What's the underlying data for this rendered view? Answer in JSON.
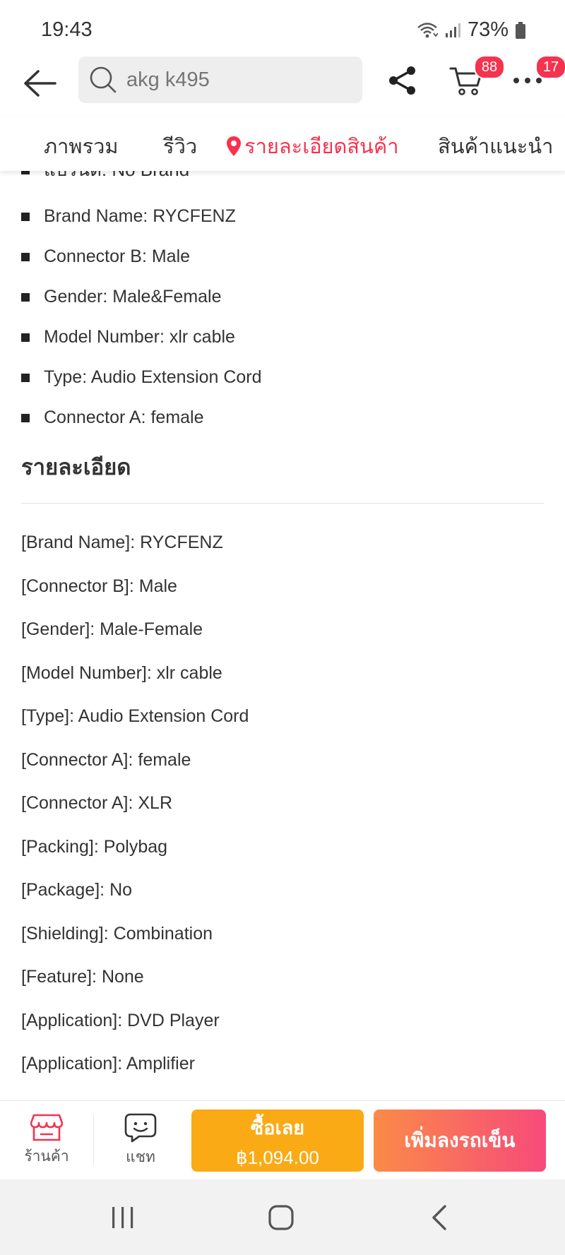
{
  "status_bar": {
    "time": "19:43",
    "battery": "73%",
    "icons": [
      "wifi-icon",
      "signal-icon",
      "battery-icon"
    ]
  },
  "header": {
    "search": {
      "value": "",
      "placeholder": "akg k495"
    },
    "cart_badge": "88",
    "more_badge": "17",
    "icons": [
      "back-arrow-icon",
      "search-icon",
      "share-icon",
      "cart-icon",
      "more-icon"
    ]
  },
  "tabs": [
    {
      "label": "ภาพรวม",
      "active": false
    },
    {
      "label": "รีวิว",
      "active": false
    },
    {
      "label": "รายละเอียดสินค้า",
      "active": true
    },
    {
      "label": "สินค้าแนะนำ",
      "active": false
    }
  ],
  "details": {
    "cut_row": "แบรนด์: No Brand",
    "bullets": [
      "Brand Name: RYCFENZ",
      "Connector B: Male",
      "Gender: Male&Female",
      "Model Number: xlr cable",
      "Type: Audio Extension Cord",
      "Connector A: female"
    ],
    "section_title": "รายละเอียด",
    "specs": [
      "[Brand Name]: RYCFENZ",
      "[Connector B]: Male",
      "[Gender]: Male-Female",
      "[Model Number]: xlr cable",
      "[Type]: Audio Extension Cord",
      "[Connector A]: female",
      "[Connector A]: XLR",
      "[Packing]: Polybag",
      "[Package]: No",
      "[Shielding]: Combination",
      "[Feature]: None",
      "[Application]: DVD Player",
      "[Application]: Amplifier"
    ]
  },
  "action_bar": {
    "store_label": "ร้านค้า",
    "chat_label": "แชท",
    "buy_now_label": "ซื้อเลย",
    "buy_now_price": "฿1,094.00",
    "add_to_cart_label": "เพิ่มลงรถเข็น"
  },
  "colors": {
    "accent": "#f5334f",
    "buy_button": "#faaa14",
    "cart_button_start": "#fb8b48",
    "cart_button_end": "#f74a7a",
    "badge": "#f5334f"
  }
}
